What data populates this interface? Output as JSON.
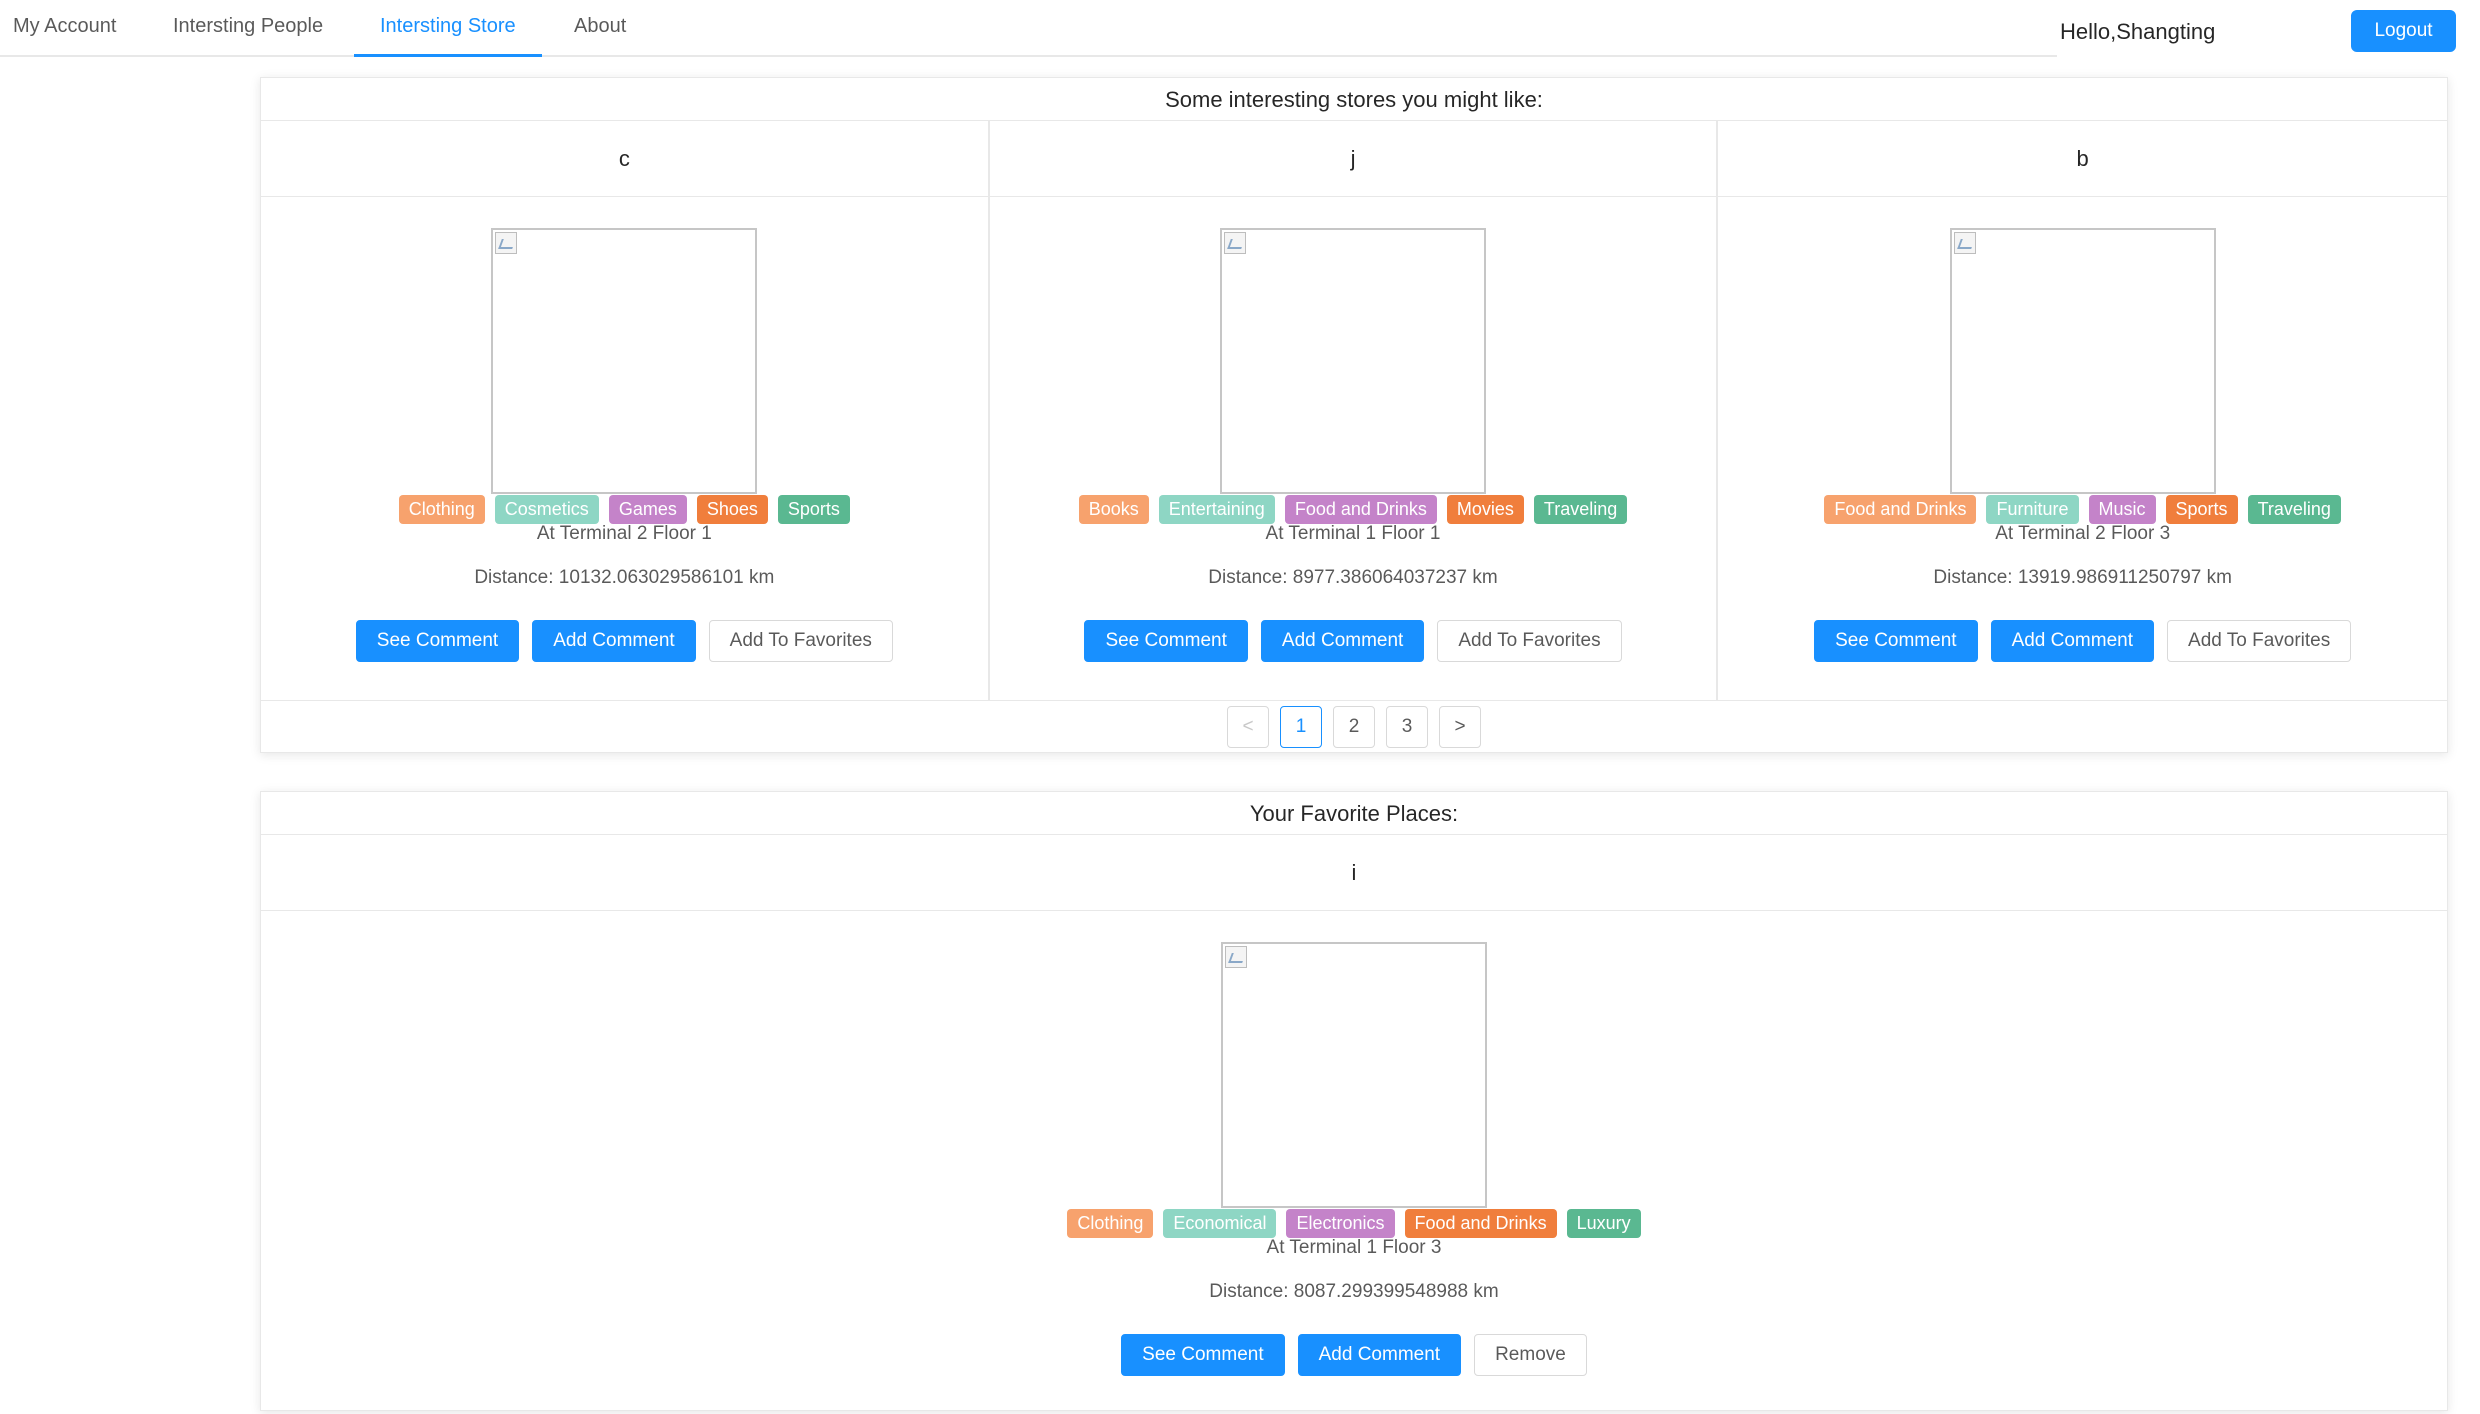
{
  "nav": {
    "items": [
      "My Account",
      "Intersting People",
      "Intersting Store",
      "About"
    ],
    "active_index": 2,
    "greeting": "Hello,Shangting",
    "logout_label": "Logout"
  },
  "suggestions": {
    "heading": "Some interesting stores you might like:",
    "stores": [
      {
        "name": "c",
        "tags": [
          "Clothing",
          "Cosmetics",
          "Games",
          "Shoes",
          "Sports"
        ],
        "location": "At Terminal 2 Floor 1",
        "distance": "Distance: 10132.063029586101 km",
        "buttons": [
          "See Comment",
          "Add Comment",
          "Add To Favorites"
        ]
      },
      {
        "name": "j",
        "tags": [
          "Books",
          "Entertaining",
          "Food and Drinks",
          "Movies",
          "Traveling"
        ],
        "location": "At Terminal 1 Floor 1",
        "distance": "Distance: 8977.386064037237 km",
        "buttons": [
          "See Comment",
          "Add Comment",
          "Add To Favorites"
        ]
      },
      {
        "name": "b",
        "tags": [
          "Food and Drinks",
          "Furniture",
          "Music",
          "Sports",
          "Traveling"
        ],
        "location": "At Terminal 2 Floor 3",
        "distance": "Distance: 13919.986911250797 km",
        "buttons": [
          "See Comment",
          "Add Comment",
          "Add To Favorites"
        ]
      }
    ],
    "pagination": {
      "prev": "<",
      "pages": [
        "1",
        "2",
        "3"
      ],
      "current": "1",
      "next": ">"
    }
  },
  "favorites": {
    "heading": "Your Favorite Places:",
    "store": {
      "name": "i",
      "tags": [
        "Clothing",
        "Economical",
        "Electronics",
        "Food and Drinks",
        "Luxury"
      ],
      "location": "At Terminal 1 Floor 3",
      "distance": "Distance: 8087.299399548988 km",
      "buttons": [
        "See Comment",
        "Add Comment",
        "Remove"
      ]
    }
  },
  "colors": {
    "primary": "#1890ff",
    "tag_palette": [
      "#f7a26d",
      "#8ed6c4",
      "#c483c9",
      "#f07e3c",
      "#5ab891"
    ]
  }
}
